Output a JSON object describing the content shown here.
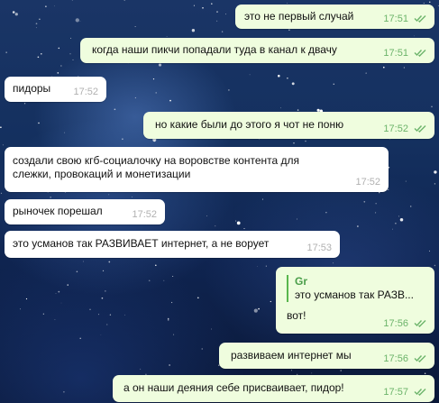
{
  "messages": [
    {
      "text": "это не первый случай",
      "time": "17:51"
    },
    {
      "text": "когда наши пикчи попадали туда в канал к двачу",
      "time": "17:51"
    },
    {
      "text": "пидоры",
      "time": "17:52"
    },
    {
      "text": "но какие были до этого я чот не поню",
      "time": "17:52"
    },
    {
      "text": "создали свою кгб-социалочку на воровстве контента для слежки, провокаций и монетизации",
      "time": "17:52"
    },
    {
      "text": "рыночек порешал",
      "time": "17:52"
    },
    {
      "text": "это усманов так РАЗВИВАЕТ интернет, а не ворует",
      "time": "17:53"
    },
    {
      "text": "вот!",
      "time": "17:56",
      "reply_author": "Gr",
      "reply_text": "это усманов так РАЗВ..."
    },
    {
      "text": "развиваем интернет мы",
      "time": "17:56"
    },
    {
      "text": "а он наши деяния себе присваивает, пидор!",
      "time": "17:57"
    }
  ],
  "colors": {
    "outgoing_bubble": "#effdde",
    "incoming_bubble": "#ffffff",
    "outgoing_meta": "#6cb46a",
    "incoming_meta": "#b1b1b1",
    "reply_accent": "#59b64e"
  },
  "icons": {
    "read_receipt": "double-check-icon"
  }
}
